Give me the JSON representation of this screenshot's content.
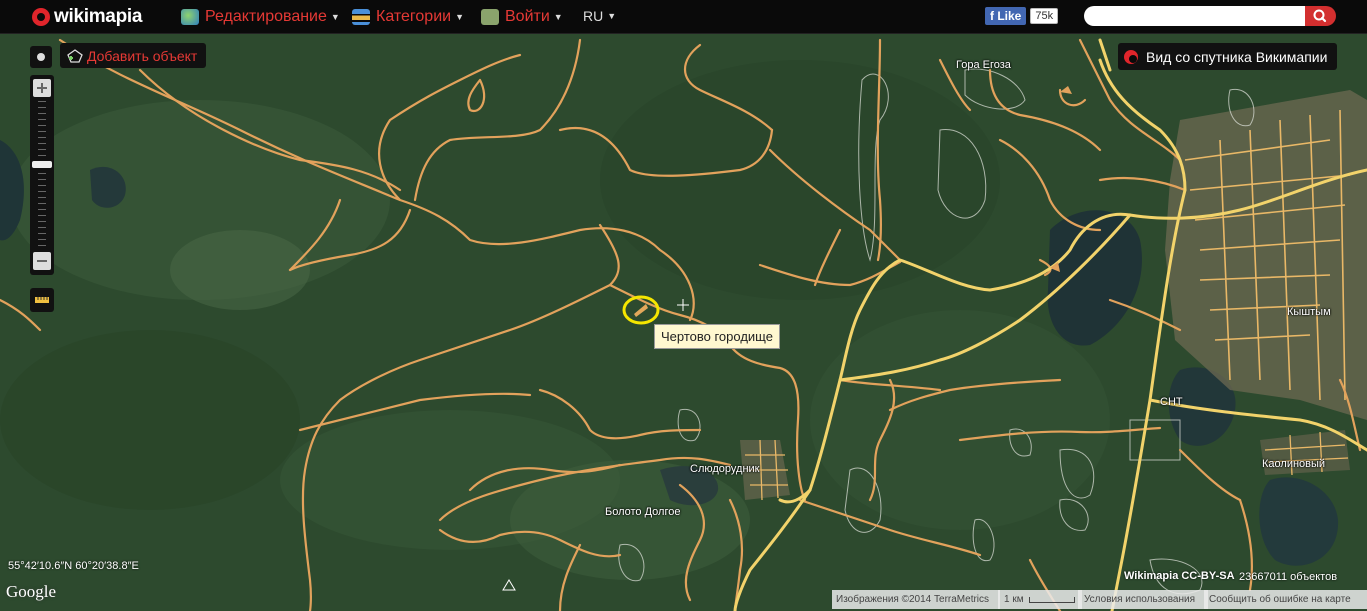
{
  "header": {
    "logo_text": "wikimapia",
    "menu": [
      {
        "label": "Редактирование",
        "icon": "globe-edit-icon"
      },
      {
        "label": "Категории",
        "icon": "categories-icon"
      },
      {
        "label": "Войти",
        "icon": "login-icon"
      }
    ],
    "language": "RU",
    "fb_like_label": "Like",
    "fb_count": "75k",
    "search": {
      "value": "",
      "placeholder": ""
    }
  },
  "map": {
    "add_object_label": "Добавить объект",
    "satellite_view_label": "Вид со спутника Викимапии",
    "tooltip": "Чертово городище",
    "labels": [
      {
        "text": "Гора Егоза"
      },
      {
        "text": "Кыштым"
      },
      {
        "text": "СНТ"
      },
      {
        "text": "Каолиновый"
      },
      {
        "text": "Слюдорудник"
      },
      {
        "text": "Болото Долгое"
      }
    ],
    "coordinates": "55°42′10.6″N 60°20′38.8″E",
    "google_label": "Google",
    "license_label": "Wikimapia CC-BY-SA",
    "objects_count": "23667011 объектов",
    "imagery_credit": "Изображения ©2014 TerraMetrics",
    "scale_label": "1 км",
    "terms_label": "Условия использования",
    "report_error": "Сообщить об ошибке на карте",
    "colors": {
      "road": "#e0a15b",
      "major_road": "#f0d070",
      "forest": "#2c4a2e",
      "accent": "#e53935",
      "highlight": "#f5e600"
    }
  }
}
